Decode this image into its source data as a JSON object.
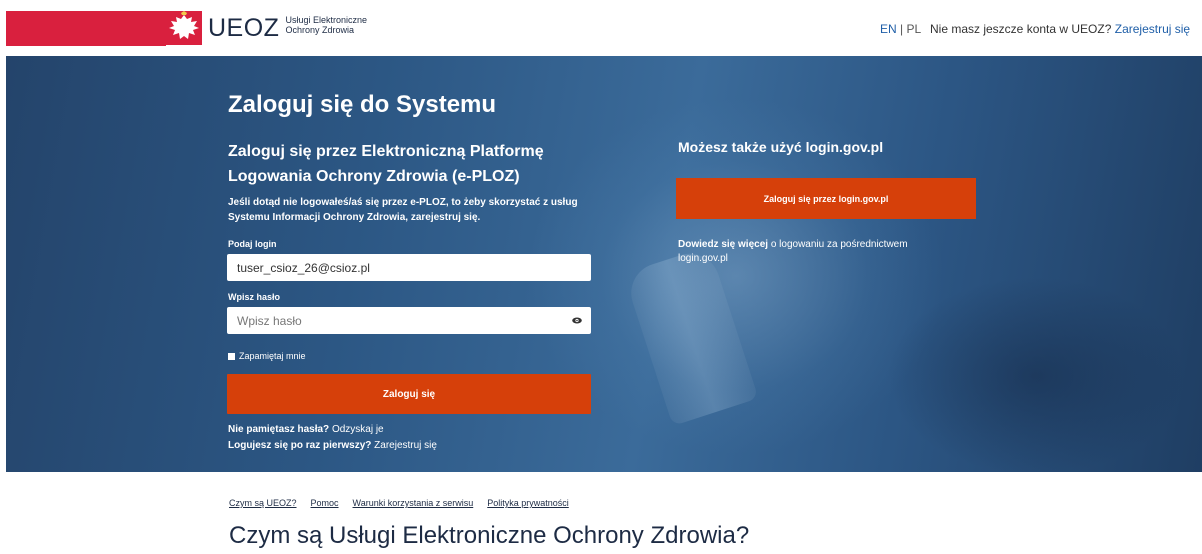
{
  "header": {
    "logo_text": "UEOZ",
    "logo_subtitle_line1": "Usługi Elektroniczne",
    "logo_subtitle_line2": "Ochrony Zdrowia",
    "lang_en": "EN",
    "lang_separator": " | ",
    "lang_pl": "PL",
    "signup_prompt": "Nie masz jeszcze konta w UEOZ?",
    "signup_link": "Zarejestruj się"
  },
  "login": {
    "title": "Zaloguj się do Systemu",
    "subtitle": "Zaloguj się przez Elektroniczną Platformę Logowania Ochrony Zdrowia (e-PLOZ)",
    "intro": "Jeśli dotąd nie logowałeś/aś się przez e-PLOZ, to żeby skorzystać z usług Systemu Informacji Ochrony Zdrowia, zarejestruj się.",
    "login_label": "Podaj login",
    "login_value": "tuser_csioz_26@csioz.pl",
    "password_label": "Wpisz hasło",
    "password_placeholder": "Wpisz hasło",
    "remember_label": "Zapamiętaj mnie",
    "submit_label": "Zaloguj się",
    "forgot_prefix": "Nie pamiętasz hasła?",
    "forgot_link": "Odzyskaj je",
    "first_time_prefix": "Logujesz się po raz pierwszy?",
    "first_time_link": "Zarejestruj się"
  },
  "alt_login": {
    "title": "Możesz także użyć login.gov.pl",
    "button_label": "Zaloguj się przez login.gov.pl",
    "learn_bold": "Dowiedz się więcej",
    "learn_rest": "o logowaniu za pośrednictwem login.gov.pl"
  },
  "footer": {
    "nav": [
      "Czym są UEOZ?",
      "Pomoc",
      "Warunki korzystania z serwisu",
      "Polityka prywatności"
    ],
    "section_title": "Czym są Usługi Elektroniczne Ochrony Zdrowia?"
  },
  "colors": {
    "brand_red": "#d9203e",
    "button_orange": "#d6400a",
    "hero_blue": "#2c5784",
    "link_blue": "#1f5fa8"
  },
  "icons": [
    "eagle-emblem-icon",
    "eye-icon"
  ]
}
